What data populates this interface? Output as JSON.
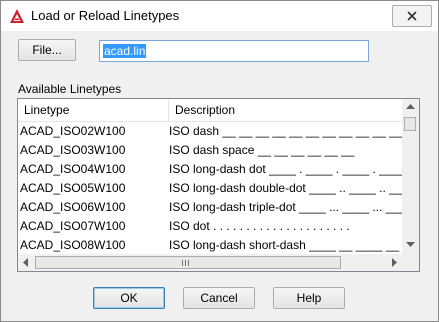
{
  "window": {
    "title": "Load or Reload Linetypes",
    "app_icon": "autocad-logo-icon",
    "close_icon": "close-icon"
  },
  "file": {
    "button_label": "File...",
    "value": "acad.lin"
  },
  "available_label": "Available Linetypes",
  "table": {
    "columns": [
      "Linetype",
      "Description"
    ],
    "rows": [
      {
        "linetype": "ACAD_ISO02W100",
        "description": "ISO dash __ __ __ __ __ __ __ __ __ __ __ __ __"
      },
      {
        "linetype": "ACAD_ISO03W100",
        "description": "ISO dash space __    __    __    __    __    __"
      },
      {
        "linetype": "ACAD_ISO04W100",
        "description": "ISO long-dash dot ____ . ____ . ____ . ____ . _"
      },
      {
        "linetype": "ACAD_ISO05W100",
        "description": "ISO long-dash double-dot ____ .. ____ .. ____ ."
      },
      {
        "linetype": "ACAD_ISO06W100",
        "description": "ISO long-dash triple-dot ____ ... ____ ... ____"
      },
      {
        "linetype": "ACAD_ISO07W100",
        "description": "ISO dot . . . . . . . . . . . . . . . . . . . . ."
      },
      {
        "linetype": "ACAD_ISO08W100",
        "description": "ISO long-dash short-dash ____ __ ____ __ ____ _"
      }
    ],
    "scroll_icons": {
      "up": "scroll-up-arrow-icon",
      "down": "scroll-down-arrow-icon",
      "left": "scroll-left-arrow-icon",
      "right": "scroll-right-arrow-icon"
    }
  },
  "buttons": {
    "ok": "OK",
    "cancel": "Cancel",
    "help": "Help"
  }
}
